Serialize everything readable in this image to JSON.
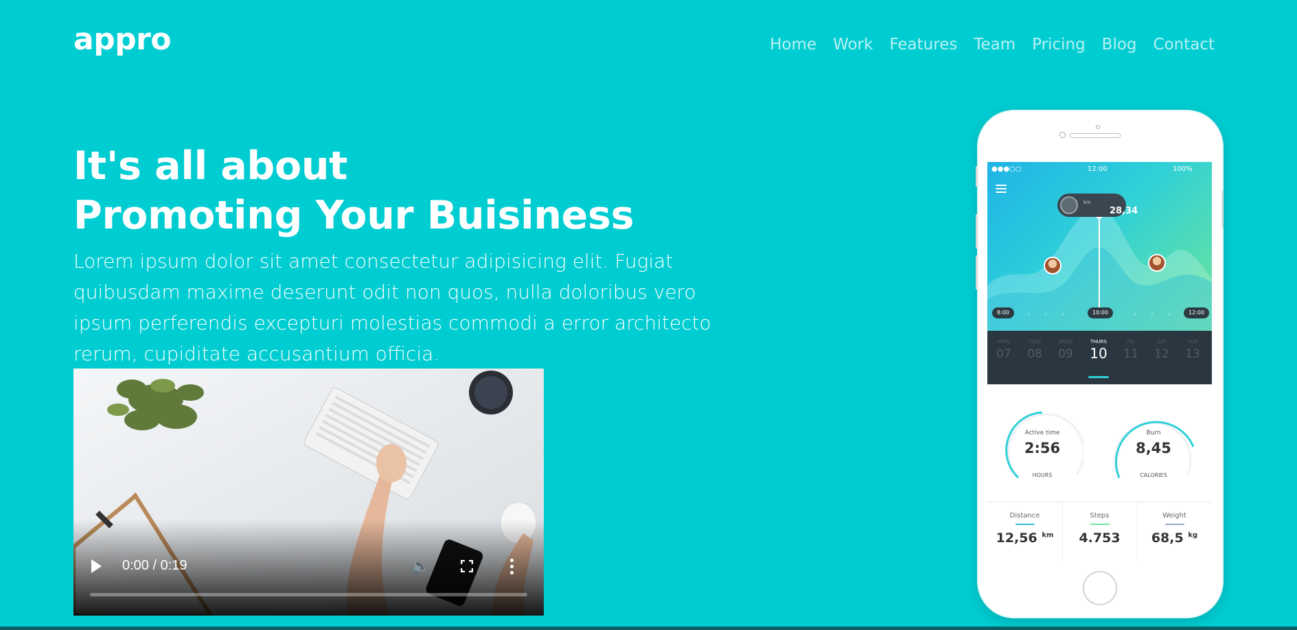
{
  "brand": {
    "logo": "appro"
  },
  "nav": [
    "Home",
    "Work",
    "Features",
    "Team",
    "Pricing",
    "Blog",
    "Contact"
  ],
  "hero": {
    "title_line1": "It's all about",
    "title_line2": "Promoting Your Buisiness",
    "text": "Lorem ipsum dolor sit amet consectetur adipisicing elit. Fugiat quibusdam maxime deserunt odit non quos, nulla doloribus vero ipsum perferendis excepturi molestias commodi a error architecto rerum, cupiditate accusantium officia."
  },
  "video": {
    "time": "0:00 / 0:19",
    "progress": 0
  },
  "phone": {
    "status": {
      "time": "12:00",
      "battery": "100%"
    },
    "pill_value": "28,34",
    "pill_unit": "km",
    "chips": [
      "8:00",
      "10:00",
      "12:00"
    ],
    "days": [
      {
        "name": "MON",
        "num": "07"
      },
      {
        "name": "TUES",
        "num": "08"
      },
      {
        "name": "WEDS",
        "num": "09"
      },
      {
        "name": "THURS",
        "num": "10",
        "selected": true
      },
      {
        "name": "FRI",
        "num": "11"
      },
      {
        "name": "SAT",
        "num": "12"
      },
      {
        "name": "SUN",
        "num": "13"
      }
    ],
    "metrics": [
      {
        "label": "Active time",
        "value": "2:56",
        "unit": "HOURS"
      },
      {
        "label": "Burn",
        "value": "8,45",
        "unit": "CALORIES"
      }
    ],
    "stats": [
      {
        "label": "Distance",
        "value": "12,56",
        "unit": "km",
        "color": "#2fb8e0"
      },
      {
        "label": "Steps",
        "value": "4.753",
        "unit": "",
        "color": "#6ee59b"
      },
      {
        "label": "Weight",
        "value": "68,5",
        "unit": "kg",
        "color": "#9aa4c7"
      }
    ]
  },
  "colors": {
    "background": "#00cdd2",
    "nav_text": "#b9f1f3",
    "phone_accent": "#2fd0d8"
  }
}
